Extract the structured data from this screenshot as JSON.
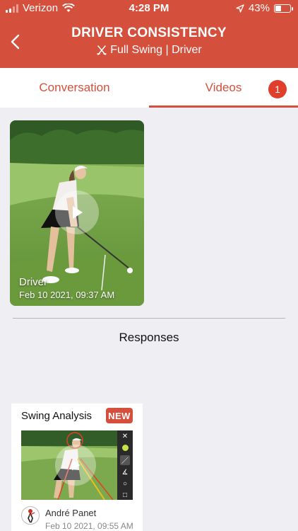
{
  "status": {
    "carrier": "Verizon",
    "time": "4:28 PM",
    "battery_text": "43%",
    "battery_level": 0.43
  },
  "header": {
    "title": "DRIVER CONSISTENCY",
    "subtitle": "Full Swing | Driver",
    "bg_color": "#d4503c"
  },
  "tabs": {
    "conversation": "Conversation",
    "videos": "Videos",
    "videos_badge": "1",
    "active": "videos"
  },
  "video": {
    "name": "Driver",
    "date": "Feb 10 2021, 09:37 AM"
  },
  "responses": {
    "title": "Responses",
    "items": [
      {
        "title": "Swing Analysis",
        "badge": "NEW",
        "author": "André Panet",
        "date": "Feb 10 2021, 09:55 AM"
      }
    ]
  }
}
